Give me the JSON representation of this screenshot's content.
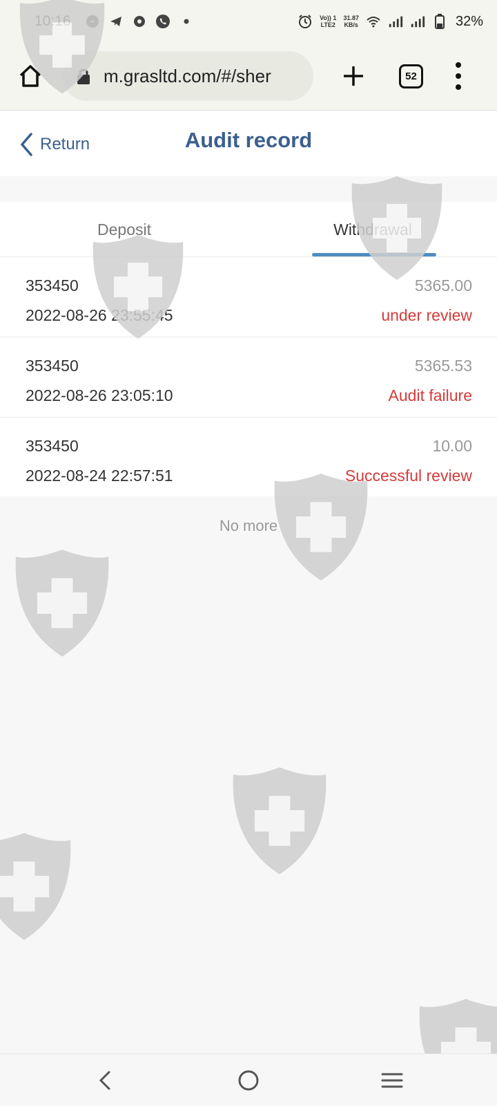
{
  "status_bar": {
    "time": "10:16",
    "net_label_top": "Vo)) 1",
    "net_label_bottom": "LTE2",
    "speed_top": "31.87",
    "speed_bottom": "KB/s",
    "battery": "32%"
  },
  "browser": {
    "url": "m.grasltd.com/#/sher",
    "tab_count": "52"
  },
  "header": {
    "back_label": "Return",
    "title": "Audit record"
  },
  "tabs": [
    {
      "label": "Deposit",
      "active": false
    },
    {
      "label": "Withdrawal",
      "active": true
    }
  ],
  "records": [
    {
      "id": "353450",
      "amount": "5365.00",
      "time": "2022-08-26 23:55:45",
      "status": "under review"
    },
    {
      "id": "353450",
      "amount": "5365.53",
      "time": "2022-08-26 23:05:10",
      "status": "Audit failure"
    },
    {
      "id": "353450",
      "amount": "10.00",
      "time": "2022-08-24 22:57:51",
      "status": "Successful review"
    }
  ],
  "list_footer": "No more",
  "colors": {
    "accent": "#3b5f8f",
    "tab_indicator": "#4e8cc2",
    "status_red": "#d43b3b",
    "muted": "#999999"
  },
  "icons": {
    "home": "home-icon",
    "lock": "lock-icon",
    "new_tab": "plus-icon",
    "tabs": "tab-switcher-icon",
    "menu": "more-vert-icon",
    "back": "chevron-left-icon",
    "watermark": "shield-cross-icon"
  }
}
